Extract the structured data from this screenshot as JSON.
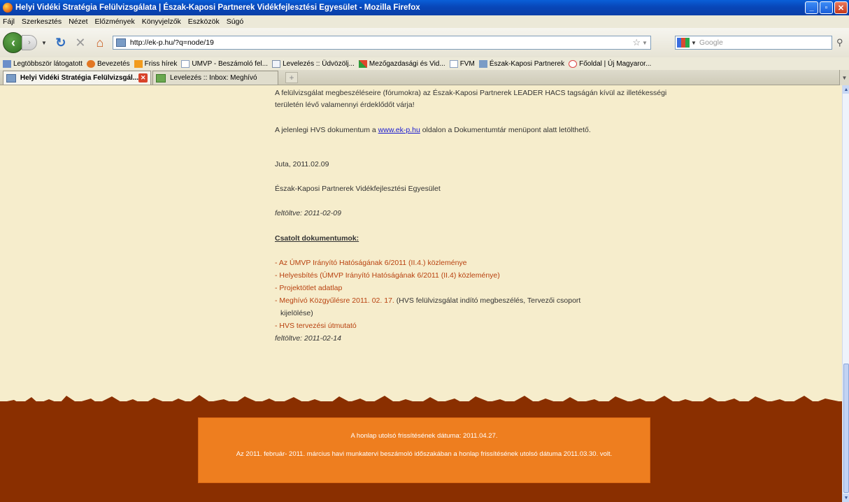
{
  "window": {
    "title": "Helyi Vidéki Stratégia Felülvizsgálata | Észak-Kaposi Partnerek Vidékfejlesztési Egyesület - Mozilla Firefox"
  },
  "menu": [
    "Fájl",
    "Szerkesztés",
    "Nézet",
    "Előzmények",
    "Könyvjelzők",
    "Eszközök",
    "Súgó"
  ],
  "navigation": {
    "url": "http://ek-p.hu/?q=node/19",
    "search_placeholder": "Google"
  },
  "bookmarks": [
    "Legtöbbször látogatott",
    "Bevezetés",
    "Friss hírek",
    "UMVP - Beszámoló fel...",
    "Levelezés :: Üdvözölj...",
    "Mezőgazdasági és Vid...",
    "FVM",
    "Észak-Kaposi Partnerek",
    "Főoldal | Új Magyaror..."
  ],
  "tabs": [
    {
      "label": "Helyi Vidéki Stratégia Felülvizsgál...",
      "active": true
    },
    {
      "label": "Levelezés :: Inbox: Meghívó",
      "active": false
    }
  ],
  "article": {
    "line1": "A felülvizsgálat megbeszéléseire (fórumokra) az Észak-Kaposi Partnerek LEADER HACS tagságán kívül az illetékességi",
    "line2": "területén lévő valamennyi érdeklődőt várja!",
    "line3_pre": "A jelenlegi HVS dokumentum a ",
    "line3_link": "www.ek-p.hu",
    "line3_post": " oldalon a Dokumentumtár menüpont alatt letölthető.",
    "place_date": "Juta, 2011.02.09",
    "org": "Észak-Kaposi Partnerek Vidékfejlesztési Egyesület",
    "uploaded1": "feltöltve: 2011-02-09",
    "attachments_heading": "Csatolt dokumentumok:",
    "attachments": [
      {
        "link": "- Az ÚMVP Irányító Hatóságának 6/2011 (II.4.) közleménye",
        "extra": ""
      },
      {
        "link": "- Helyesbítés (ÚMVP Irányító Hatóságának 6/2011 (II.4) közleménye)",
        "extra": ""
      },
      {
        "link": "- Projektötlet adatlap",
        "extra": ""
      },
      {
        "link": "- Meghívó Közgyűlésre 2011. 02. 17.",
        "extra": " (HVS felülvizsgálat indító megbeszélés, Tervezői csoport"
      },
      {
        "link": "",
        "extra": "kijelölése)"
      },
      {
        "link": "- HVS tervezési útmutató",
        "extra": ""
      }
    ],
    "uploaded2": "feltöltve: 2011-02-14"
  },
  "footer": {
    "line1": "A honlap utolsó frissítésének dátuma: 2011.04.27.",
    "line2": "Az 2011. február- 2011. március havi munkatervi beszámoló időszakában a honlap frissítésének utolsó dátuma 2011.03.30. volt."
  },
  "colors": {
    "page_bg": "#f6edcc",
    "footer_bg": "#8a2f00",
    "footer_box": "#ee7e1f",
    "attachment_link": "#b8410f"
  }
}
